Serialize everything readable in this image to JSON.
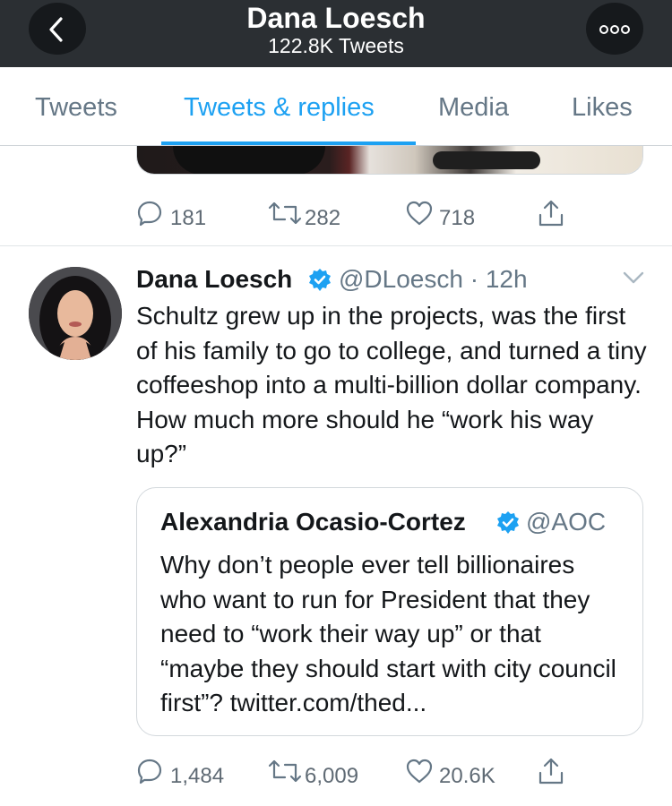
{
  "header": {
    "title": "Dana Loesch",
    "subtitle": "122.8K Tweets",
    "back_icon": "chevron-left-icon",
    "more_icon": "ellipsis-icon"
  },
  "tabs": [
    {
      "label": "Tweets",
      "active": false
    },
    {
      "label": "Tweets & replies",
      "active": true
    },
    {
      "label": "Media",
      "active": false
    },
    {
      "label": "Likes",
      "active": false
    }
  ],
  "previous_tweet": {
    "replies": "181",
    "retweets": "282",
    "likes": "718"
  },
  "tweet": {
    "author_name": "Dana Loesch",
    "verified": true,
    "handle_time": "@DLoesch · 12h",
    "text": "Schultz grew up in the projects, was the first of his family to go to college, and turned a tiny coffeeshop into a multi-billion dollar company. How much more should he “work his way up?”",
    "replies": "1,484",
    "retweets": "6,009",
    "likes": "20.6K",
    "quote": {
      "author_name": "Alexandria Ocasio-Cortez",
      "verified": true,
      "handle": "@AOC",
      "text": "Why don’t people ever tell billionaires who want to run for President that they need to “work their way up” or that “maybe they should start with city council first”? twitter.com/thed..."
    }
  },
  "colors": {
    "accent": "#1da1f2",
    "header_bg": "#2b2f33",
    "muted_text": "#657786",
    "border": "#e1e5e8"
  }
}
